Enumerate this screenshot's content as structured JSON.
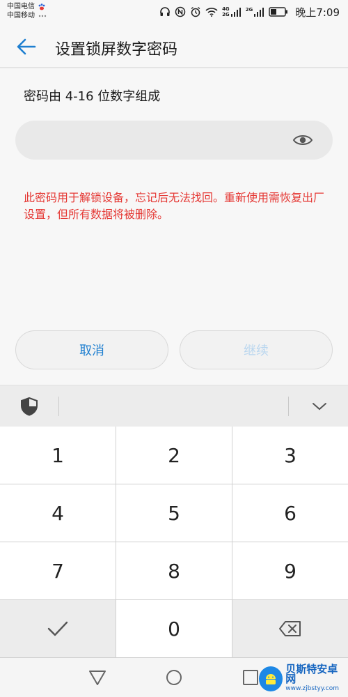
{
  "status_bar": {
    "carrier_1": "中国电信",
    "carrier_2": "中国移动",
    "network_1": "4G",
    "network_2": "2G",
    "network_3": "2G",
    "time": "晚上7:09"
  },
  "header": {
    "back_icon": "back-arrow-icon",
    "title": "设置锁屏数字密码"
  },
  "instruction": "密码由 4-16 位数字组成",
  "password_field": {
    "value": "",
    "placeholder": "",
    "visibility_icon": "eye-icon"
  },
  "warning": "此密码用于解锁设备，忘记后无法找回。重新使用需恢复出厂设置，但所有数据将被删除。",
  "buttons": {
    "cancel": "取消",
    "continue": "继续"
  },
  "keyboard": {
    "toolbar_left_icon": "shield-icon",
    "toolbar_right_icon": "chevron-down-icon",
    "keys": [
      "1",
      "2",
      "3",
      "4",
      "5",
      "6",
      "7",
      "8",
      "9",
      "✓",
      "0",
      "⌫"
    ]
  },
  "nav_bar": {
    "back_icon": "triangle-back-icon",
    "home_icon": "circle-home-icon",
    "recent_icon": "square-recent-icon"
  },
  "watermark": {
    "name": "贝斯特安卓网",
    "url": "www.zjbstyy.com"
  },
  "colors": {
    "accent_blue": "#1e7fd0",
    "disabled_blue": "#b9d6ef",
    "warning_red": "#e53935"
  }
}
